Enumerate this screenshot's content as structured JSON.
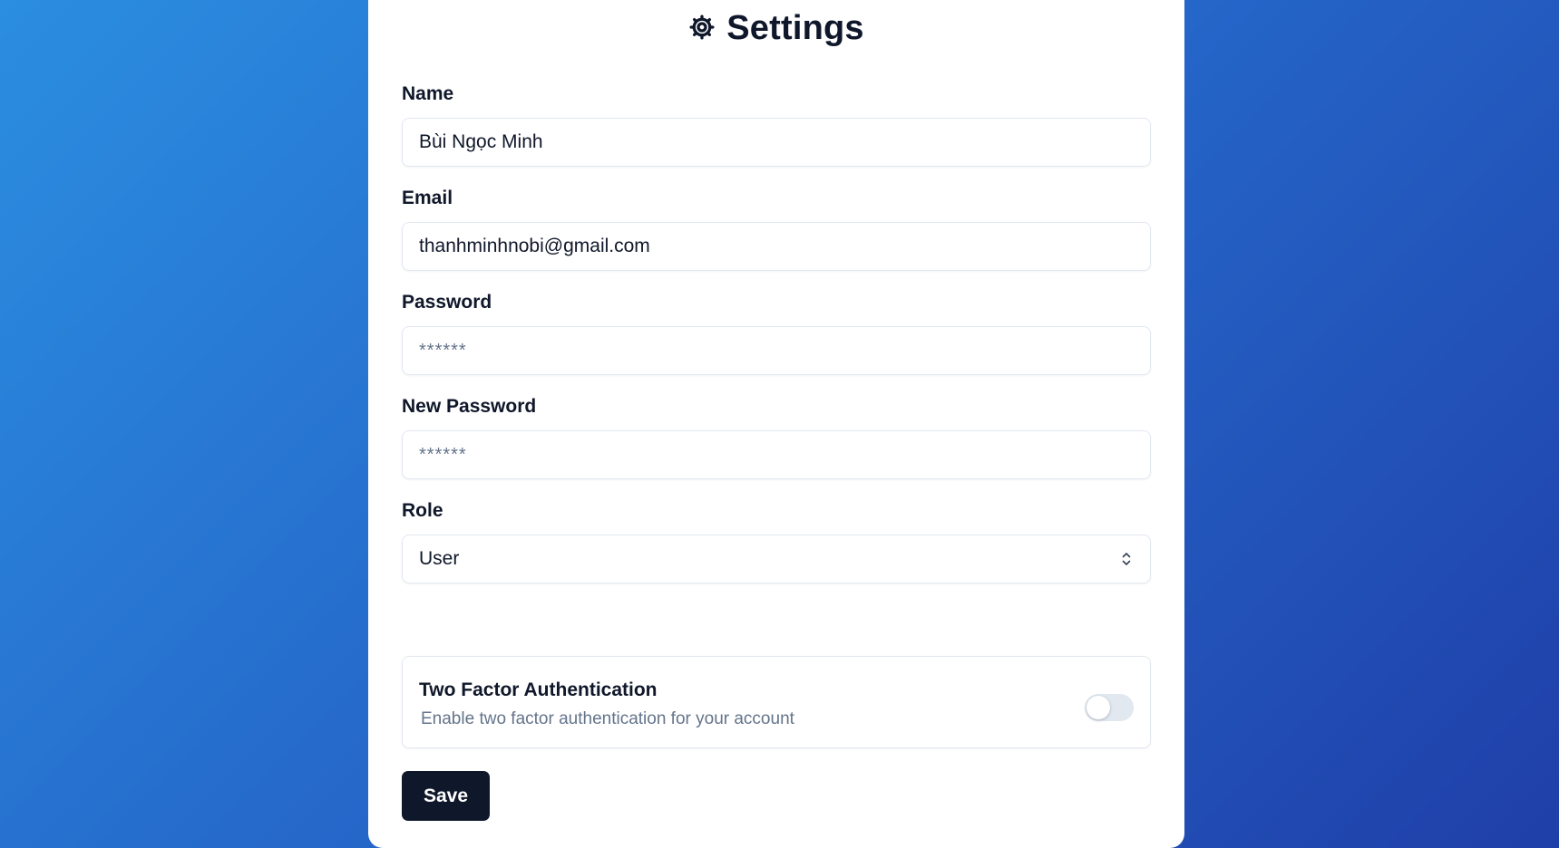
{
  "page": {
    "title": "Settings",
    "title_icon": "gear-icon"
  },
  "form": {
    "name": {
      "label": "Name",
      "value": "Bùi Ngọc Minh"
    },
    "email": {
      "label": "Email",
      "value": "thanhminhnobi@gmail.com"
    },
    "password": {
      "label": "Password",
      "placeholder": "******"
    },
    "new_password": {
      "label": "New Password",
      "placeholder": "******"
    },
    "role": {
      "label": "Role",
      "value": "User",
      "icon": "chevron-up-down-icon"
    },
    "two_factor": {
      "title": "Two Factor Authentication",
      "description": "Enable two factor authentication for your account",
      "enabled": false
    },
    "save_label": "Save"
  },
  "colors": {
    "primary": "#0f172a",
    "muted_text": "#64748b",
    "border": "#e2e8f0",
    "background_gradient_start": "#2b8ee0",
    "background_gradient_end": "#1f3fa8"
  }
}
